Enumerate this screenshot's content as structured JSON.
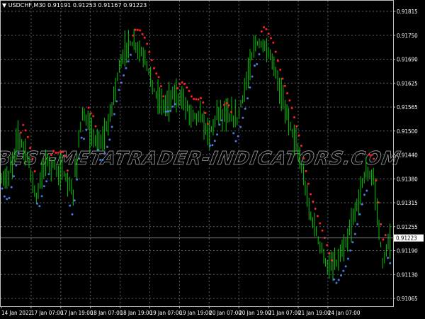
{
  "header": {
    "symbol": "USDCHF,M30",
    "open": "0.91191",
    "high": "0.91253",
    "low": "0.91167",
    "close": "0.91223"
  },
  "watermark": "BEST-METATRADER-INDICATORS.COM",
  "colors": {
    "bull": "#00c800",
    "sar_up": "#4a78e0",
    "sar_down": "#ff2020",
    "grid": "#5a6070",
    "axis": "#c0c0c0"
  },
  "chart_data": {
    "type": "candlestick",
    "title": "USDCHF,M30",
    "current_price": 0.91223,
    "ylim": [
      0.91065,
      0.91815
    ],
    "y_ticks": [
      "0.91815",
      "0.91750",
      "0.91690",
      "0.91625",
      "0.91565",
      "0.91500",
      "0.91440",
      "0.91380",
      "0.91315",
      "0.91255",
      "0.91190",
      "0.91130",
      "0.91065"
    ],
    "x_ticks": [
      "14 Jan 2022",
      "17 Jan 07:00",
      "17 Jan 19:00",
      "18 Jan 07:00",
      "18 Jan 19:00",
      "19 Jan 07:00",
      "19 Jan 19:00",
      "20 Jan 07:00",
      "20 Jan 19:00",
      "21 Jan 07:00",
      "21 Jan 19:00",
      "24 Jan 07:00"
    ],
    "price_path": [
      0.91373,
      0.91382,
      0.91493,
      0.91438,
      0.91327,
      0.91428,
      0.9141,
      0.91391,
      0.91336,
      0.91549,
      0.91493,
      0.91465,
      0.9153,
      0.9166,
      0.91734,
      0.91724,
      0.91687,
      0.91604,
      0.91567,
      0.91595,
      0.91586,
      0.91549,
      0.91539,
      0.91493,
      0.91558,
      0.91539,
      0.9153,
      0.91623,
      0.91734,
      0.91724,
      0.91678,
      0.91586,
      0.91512,
      0.91419,
      0.9129,
      0.91216,
      0.91142,
      0.9116,
      0.91206,
      0.9129,
      0.91391,
      0.91382,
      0.9116,
      0.91223
    ],
    "series": [
      {
        "name": "Price bars"
      },
      {
        "name": "Parabolic SAR up"
      },
      {
        "name": "Parabolic SAR down"
      }
    ]
  }
}
